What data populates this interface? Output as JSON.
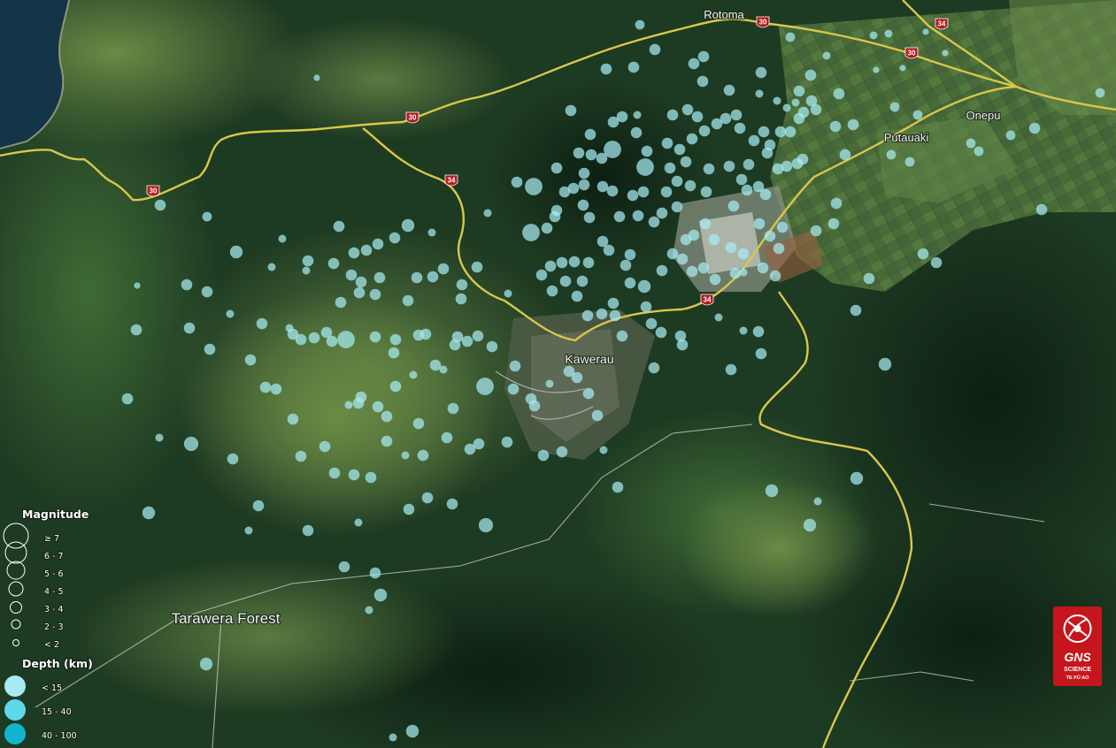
{
  "places": [
    {
      "key": "rotoma",
      "label": "Rotoma"
    },
    {
      "key": "onepu",
      "label": "Onepu"
    },
    {
      "key": "putauaki",
      "label": "Putauaki"
    },
    {
      "key": "kawerau",
      "label": "Kawerau"
    },
    {
      "key": "tarawera-forest",
      "label": "Tarawera Forest"
    }
  ],
  "route_shields": [
    {
      "label": "30"
    },
    {
      "label": "30"
    },
    {
      "label": "30"
    },
    {
      "label": "30"
    },
    {
      "label": "34"
    },
    {
      "label": "34"
    },
    {
      "label": "34"
    }
  ],
  "legend": {
    "magnitude_title": "Magnitude",
    "magnitude_classes": [
      "≥ 7",
      "6 - 7",
      "5 - 6",
      "4 - 5",
      "3 - 4",
      "2 - 3",
      "< 2"
    ],
    "depth_title": "Depth (km)",
    "depth_classes": [
      {
        "label": "< 15",
        "color": "#a6ebf2"
      },
      {
        "label": "15 - 40",
        "color": "#5fd8ea"
      },
      {
        "label": "40 - 100",
        "color": "#13b4cf"
      }
    ]
  },
  "logo": {
    "line1": "GNS",
    "line2": "SCIENCE",
    "line3": "TE PŪ AO",
    "color": "#c4161c"
  },
  "colors": {
    "quake_fill": "#a6ebf2",
    "road_main": "#d9c74a",
    "road_minor": "#cfcfcf"
  }
}
